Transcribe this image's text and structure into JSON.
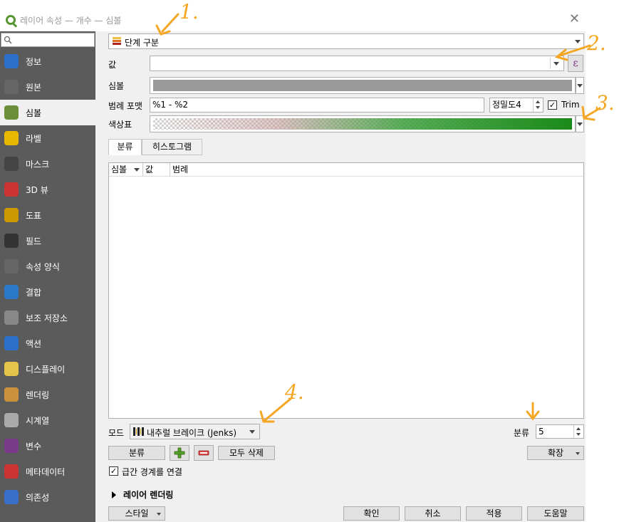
{
  "window": {
    "title": "레이어 속성 — 개수 — 심볼",
    "close": "✕"
  },
  "sidebar": {
    "items": [
      {
        "label": "정보",
        "icon": "info-icon"
      },
      {
        "label": "원본",
        "icon": "source-icon"
      },
      {
        "label": "심볼",
        "icon": "symbology-icon"
      },
      {
        "label": "라벨",
        "icon": "labels-icon"
      },
      {
        "label": "마스크",
        "icon": "mask-icon"
      },
      {
        "label": "3D 뷰",
        "icon": "3d-view-icon"
      },
      {
        "label": "도표",
        "icon": "diagrams-icon"
      },
      {
        "label": "필드",
        "icon": "fields-icon"
      },
      {
        "label": "속성 양식",
        "icon": "attributes-form-icon"
      },
      {
        "label": "결합",
        "icon": "joins-icon"
      },
      {
        "label": "보조 저장소",
        "icon": "auxiliary-storage-icon"
      },
      {
        "label": "액션",
        "icon": "actions-icon"
      },
      {
        "label": "디스플레이",
        "icon": "display-icon"
      },
      {
        "label": "렌더링",
        "icon": "rendering-icon"
      },
      {
        "label": "시계열",
        "icon": "temporal-icon"
      },
      {
        "label": "변수",
        "icon": "variables-icon"
      },
      {
        "label": "메타데이터",
        "icon": "metadata-icon"
      },
      {
        "label": "의존성",
        "icon": "dependencies-icon"
      }
    ],
    "active_index": 2
  },
  "renderer": {
    "type": "단계 구분"
  },
  "form": {
    "value_label": "값",
    "value": "",
    "expression_symbol": "ε",
    "symbol_label": "심볼",
    "legend_format_label": "범례 포맷",
    "legend_format_value": "%1 - %2",
    "precision_label": "정밀도",
    "precision_value": "4",
    "trim_label": "Trim",
    "trim_checked": true,
    "color_ramp_label": "색상표"
  },
  "tabs": [
    "분류",
    "히스토그램"
  ],
  "table": {
    "columns": [
      "심볼",
      "값",
      "범례"
    ]
  },
  "mode": {
    "label": "모드",
    "value": "내추럴 브레이크 (Jenks)",
    "classes_label": "분류",
    "classes_value": "5"
  },
  "buttons": {
    "classify": "분류",
    "add": "+",
    "remove": "−",
    "delete_all": "모두 삭제",
    "advanced": "확장",
    "style": "스타일",
    "ok": "확인",
    "cancel": "취소",
    "apply": "적용",
    "help": "도움말"
  },
  "link_boundaries": {
    "label": "급간 경계를 연결",
    "checked": true
  },
  "layer_rendering": {
    "label": "레이어 렌더링"
  },
  "annotations": [
    "1.",
    "2.",
    "3.",
    "4."
  ],
  "colors": {
    "accent_annotation": "#f5a623",
    "sidebar_bg": "#5b5b5b",
    "ramp_start": "#ffffff",
    "ramp_end": "#1a8a1a",
    "symbol_fill": "#9a9a9a"
  }
}
